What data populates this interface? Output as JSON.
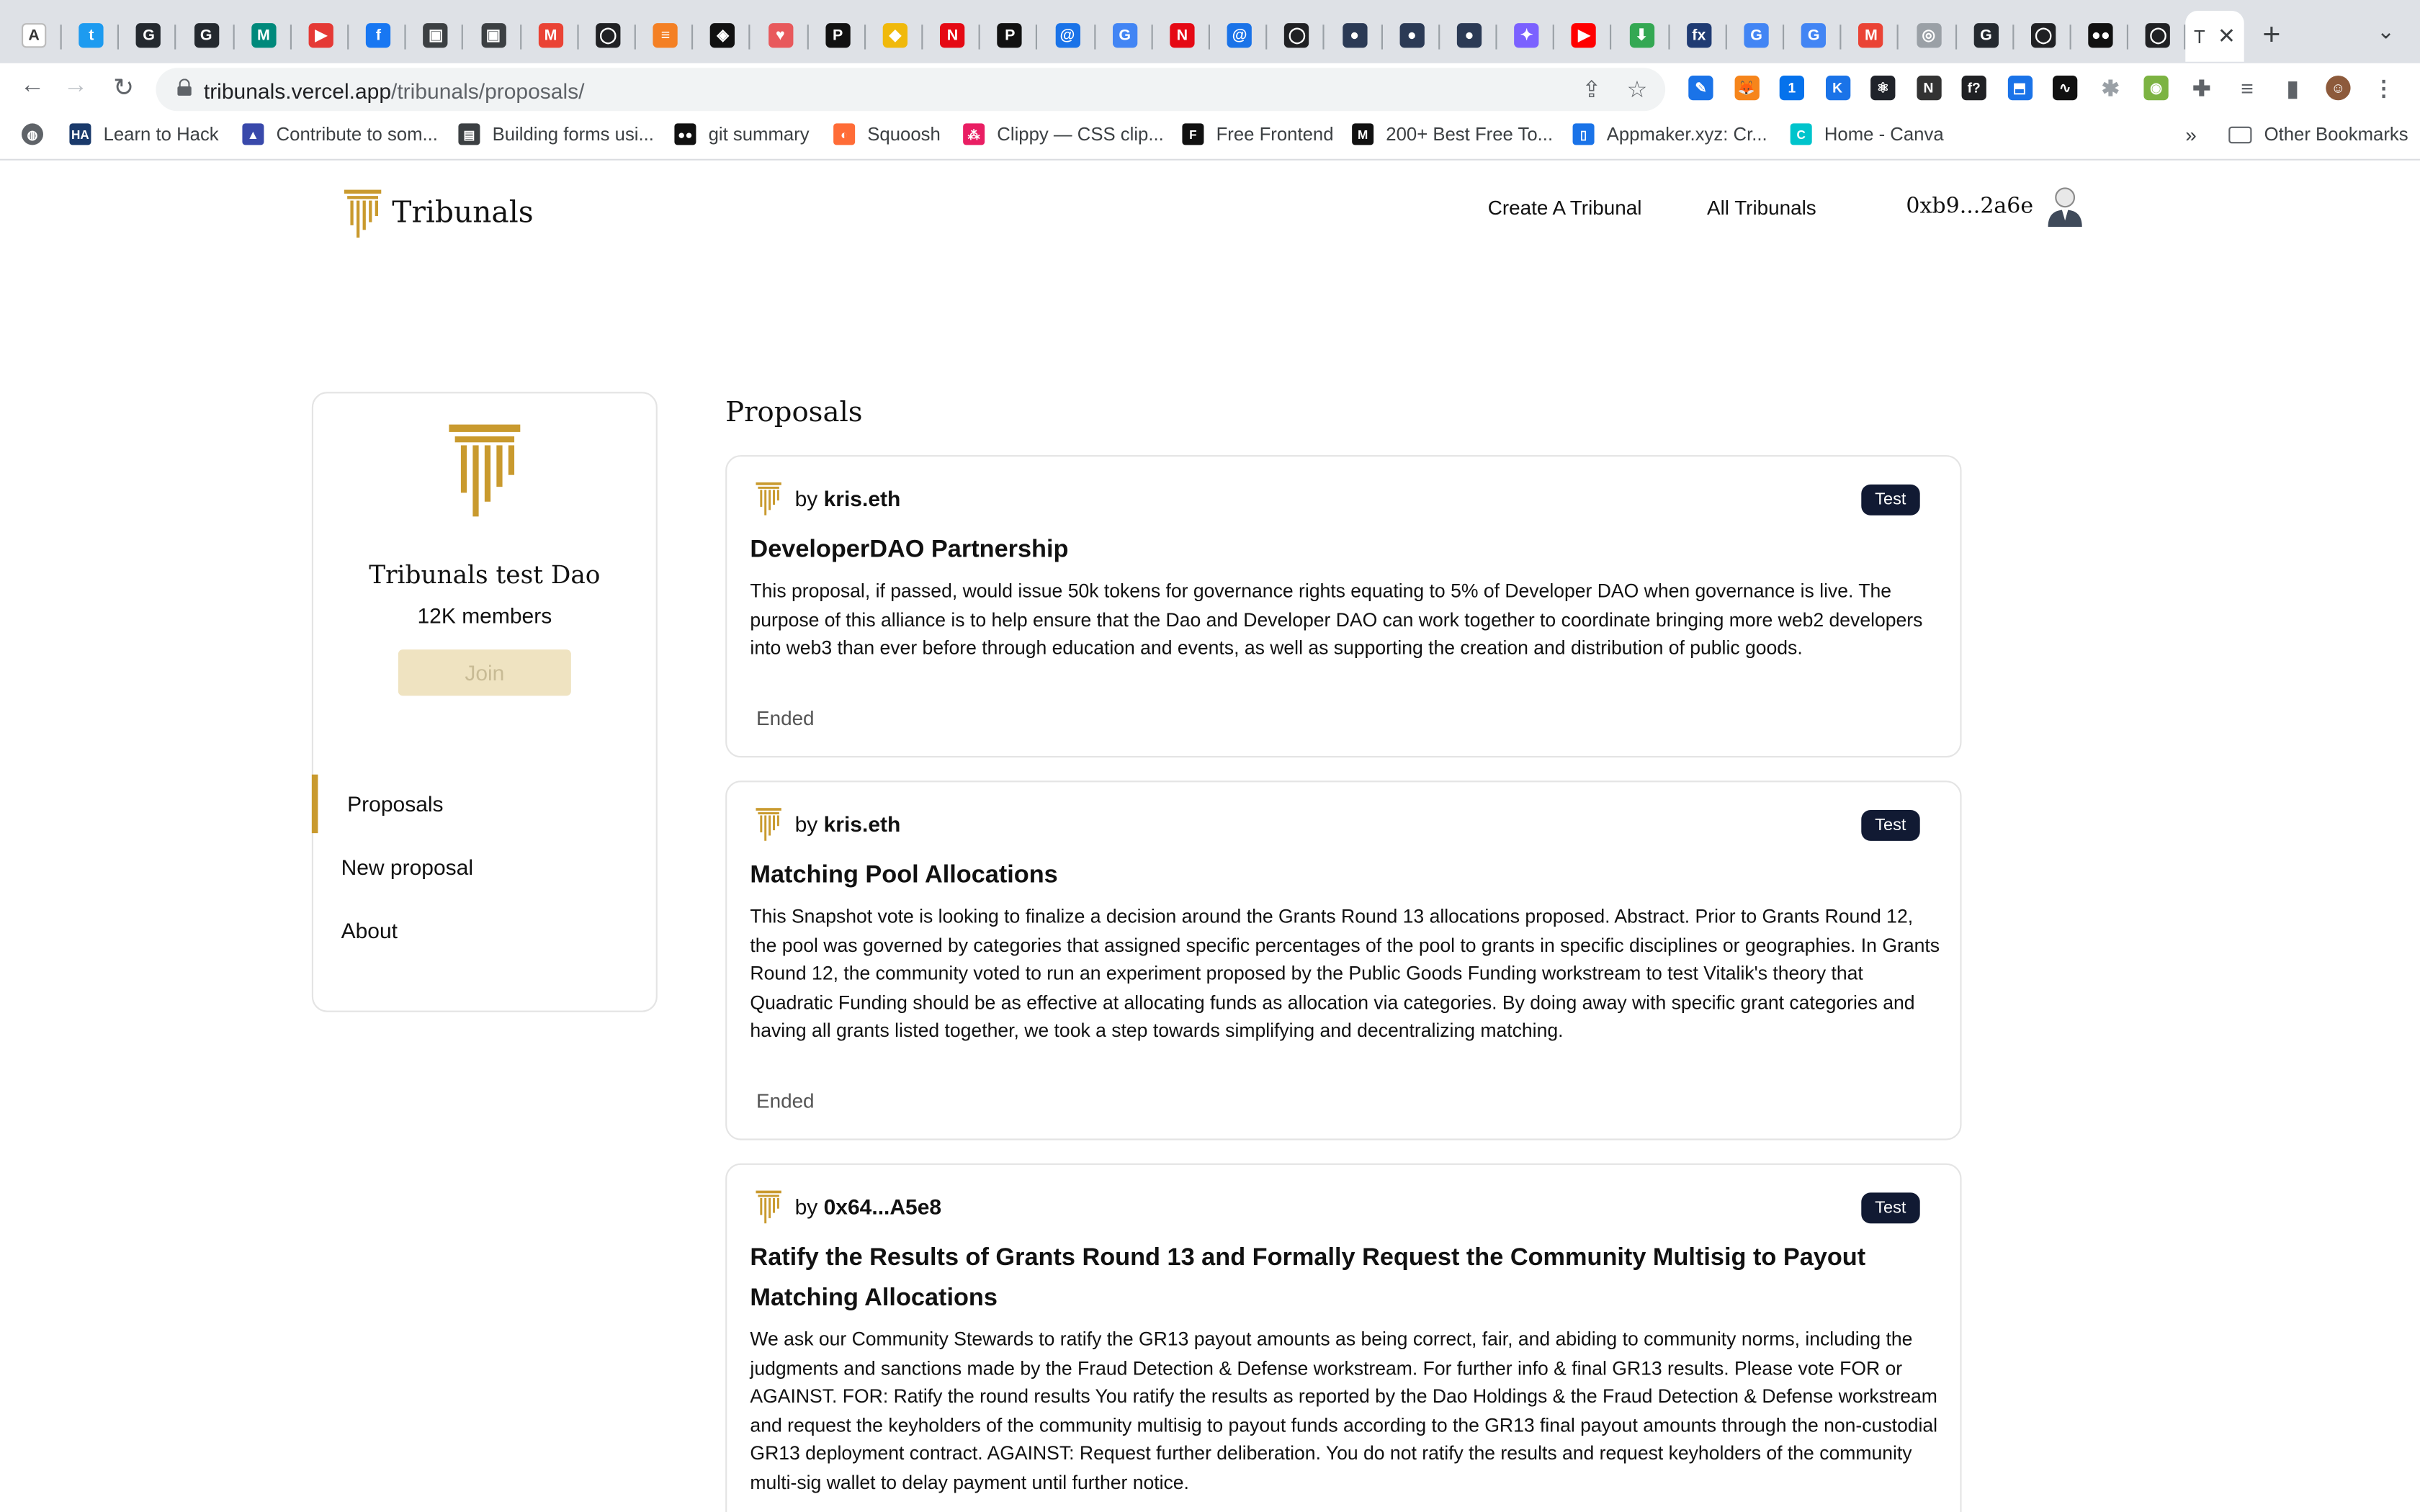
{
  "browser": {
    "url_host": "tribunals.vercel.app",
    "url_path": "/tribunals/proposals/",
    "active_tab_label": "T",
    "new_tab": "+",
    "tabs": [
      {
        "icon": "notion-icon",
        "color": "#ffffff",
        "glyph": "A"
      },
      {
        "icon": "twitter-icon",
        "color": "#1d9bf0",
        "glyph": "t"
      },
      {
        "icon": "github-icon",
        "color": "#24292f",
        "glyph": "G"
      },
      {
        "icon": "github-icon",
        "color": "#24292f",
        "glyph": "G"
      },
      {
        "icon": "meet-icon",
        "color": "#00897b",
        "glyph": "M"
      },
      {
        "icon": "youtube-music-icon",
        "color": "#e53935",
        "glyph": "▶"
      },
      {
        "icon": "facebook-icon",
        "color": "#1877f2",
        "glyph": "f"
      },
      {
        "icon": "image-icon",
        "color": "#3c4043",
        "glyph": "▣"
      },
      {
        "icon": "image-icon",
        "color": "#3c4043",
        "glyph": "▣"
      },
      {
        "icon": "gmail-icon",
        "color": "#ea4335",
        "glyph": "M"
      },
      {
        "icon": "loop-icon",
        "color": "#202124",
        "glyph": "◯"
      },
      {
        "icon": "stackoverflow-icon",
        "color": "#f48024",
        "glyph": "≡"
      },
      {
        "icon": "codesandbox-icon",
        "color": "#111111",
        "glyph": "◈"
      },
      {
        "icon": "pinterest-icon",
        "color": "#e8595c",
        "glyph": "♥"
      },
      {
        "icon": "product-hunt-icon",
        "color": "#111111",
        "glyph": "P"
      },
      {
        "icon": "binance-icon",
        "color": "#f0b90b",
        "glyph": "◆"
      },
      {
        "icon": "netflix-icon",
        "color": "#e50914",
        "glyph": "N"
      },
      {
        "icon": "product-hunt-icon",
        "color": "#111111",
        "glyph": "P"
      },
      {
        "icon": "at-sign-icon",
        "color": "#1a73e8",
        "glyph": "@"
      },
      {
        "icon": "google-icon",
        "color": "#4285f4",
        "glyph": "G"
      },
      {
        "icon": "netflix-icon",
        "color": "#e50914",
        "glyph": "N"
      },
      {
        "icon": "at-sign-icon",
        "color": "#1a73e8",
        "glyph": "@"
      },
      {
        "icon": "loop-icon",
        "color": "#202124",
        "glyph": "◯"
      },
      {
        "icon": "globe-icon",
        "color": "#2b3a55",
        "glyph": "●"
      },
      {
        "icon": "globe-icon",
        "color": "#2b3a55",
        "glyph": "●"
      },
      {
        "icon": "globe-icon",
        "color": "#2b3a55",
        "glyph": "●"
      },
      {
        "icon": "messenger-icon",
        "color": "#7b61ff",
        "glyph": "✦"
      },
      {
        "icon": "youtube-icon",
        "color": "#ff0000",
        "glyph": "▶"
      },
      {
        "icon": "download-icon",
        "color": "#34a853",
        "glyph": "⬇"
      },
      {
        "icon": "fx-icon",
        "color": "#1f3b73",
        "glyph": "fx"
      },
      {
        "icon": "google-icon",
        "color": "#4285f4",
        "glyph": "G"
      },
      {
        "icon": "google-icon",
        "color": "#4285f4",
        "glyph": "G"
      },
      {
        "icon": "gmail-icon",
        "color": "#ea4335",
        "glyph": "M"
      },
      {
        "icon": "apps-icon",
        "color": "#9aa0a6",
        "glyph": "◎"
      },
      {
        "icon": "github-icon",
        "color": "#24292f",
        "glyph": "G"
      },
      {
        "icon": "loop-icon",
        "color": "#202124",
        "glyph": "◯"
      },
      {
        "icon": "medium-icon",
        "color": "#111111",
        "glyph": "●●"
      },
      {
        "icon": "loop-icon",
        "color": "#202124",
        "glyph": "◯"
      }
    ],
    "extensions": [
      {
        "icon": "pen-extension-icon",
        "color": "#1a73e8",
        "glyph": "✎"
      },
      {
        "icon": "metamask-icon",
        "color": "#f6851b",
        "glyph": "🦊"
      },
      {
        "icon": "onepassword-icon",
        "color": "#0572ec",
        "glyph": "1"
      },
      {
        "icon": "k-extension-icon",
        "color": "#1a73e8",
        "glyph": "K"
      },
      {
        "icon": "react-devtools-icon",
        "color": "#20232a",
        "glyph": "⚛"
      },
      {
        "icon": "new-extension-icon",
        "color": "#333333",
        "glyph": "N"
      },
      {
        "icon": "font-extension-icon",
        "color": "#202124",
        "glyph": "f?"
      },
      {
        "icon": "tab-extension-icon",
        "color": "#1a73e8",
        "glyph": "⬒"
      },
      {
        "icon": "wave-extension-icon",
        "color": "#111111",
        "glyph": "∿"
      },
      {
        "icon": "bug-extension-icon",
        "color": "#9aa0a6",
        "glyph": "✱"
      },
      {
        "icon": "color-extension-icon",
        "color": "#7cb342",
        "glyph": "◉"
      },
      {
        "icon": "puzzle-icon",
        "color": "#5f6368",
        "glyph": "✚"
      },
      {
        "icon": "reading-list-icon",
        "color": "#5f6368",
        "glyph": "≡"
      },
      {
        "icon": "sidepanel-icon",
        "color": "#5f6368",
        "glyph": "▮"
      },
      {
        "icon": "profile-avatar-icon",
        "color": "#8d5a3b",
        "glyph": "☺"
      },
      {
        "icon": "kebab-menu-icon",
        "color": "#5f6368",
        "glyph": "⋮"
      }
    ],
    "bookmarks": [
      {
        "label": "",
        "icon": "globe-icon",
        "color": "#5f6368",
        "glyph": "◍"
      },
      {
        "label": "Learn to Hack",
        "icon": "hackaday-icon",
        "color": "#1a3a6b",
        "glyph": "HA"
      },
      {
        "label": "Contribute to som...",
        "icon": "contribute-icon",
        "color": "#3949ab",
        "glyph": "▲"
      },
      {
        "label": "Building forms usi...",
        "icon": "form-icon",
        "color": "#3c4043",
        "glyph": "▤"
      },
      {
        "label": "git summary",
        "icon": "medium-icon",
        "color": "#111111",
        "glyph": "●●"
      },
      {
        "label": "Squoosh",
        "icon": "squoosh-icon",
        "color": "#ff6c37",
        "glyph": "◐"
      },
      {
        "label": "Clippy — CSS clip...",
        "icon": "clippy-icon",
        "color": "#e91e63",
        "glyph": "⁂"
      },
      {
        "label": "Free Frontend",
        "icon": "free-frontend-icon",
        "color": "#111111",
        "glyph": "F"
      },
      {
        "label": "200+ Best Free To...",
        "icon": "m-logo-icon",
        "color": "#111111",
        "glyph": "M"
      },
      {
        "label": "Appmaker.xyz: Cr...",
        "icon": "appmaker-icon",
        "color": "#1a73e8",
        "glyph": "▯"
      },
      {
        "label": "Home - Canva",
        "icon": "canva-icon",
        "color": "#00c4cc",
        "glyph": "C"
      }
    ],
    "bookmarks_more": "»",
    "other_bookmarks": "Other Bookmarks"
  },
  "site": {
    "brand": "Tribunals",
    "nav": {
      "create": "Create A Tribunal",
      "all": "All Tribunals"
    },
    "wallet": "0xb9...2a6e",
    "accent": "#c99a2e"
  },
  "sidebar": {
    "dao_name": "Tribunals test Dao",
    "members": "12K members",
    "join_label": "Join",
    "menu": [
      {
        "label": "Proposals",
        "active": true
      },
      {
        "label": "New proposal",
        "active": false
      },
      {
        "label": "About",
        "active": false
      }
    ]
  },
  "main": {
    "title": "Proposals",
    "proposals": [
      {
        "by_prefix": "by",
        "author": "kris.eth",
        "tag": "Test",
        "title": "DeveloperDAO Partnership",
        "body": "This proposal, if passed, would issue 50k tokens for governance rights equating to 5% of Developer DAO when governance is live. The purpose of this alliance is to help ensure that the Dao and Developer DAO can work together to coordinate bringing more web2 developers into web3 than ever before through education and events, as well as supporting the creation and distribution of public goods.",
        "status": "Ended"
      },
      {
        "by_prefix": "by",
        "author": "kris.eth",
        "tag": "Test",
        "title": "Matching Pool Allocations",
        "body": "This Snapshot vote is looking to finalize a decision around the Grants Round 13 allocations proposed. Abstract. Prior to Grants Round 12, the pool was governed by categories that assigned specific percentages of the pool to grants in specific disciplines or geographies. In Grants Round 12, the community voted to run an experiment proposed by the Public Goods Funding workstream to test Vitalik's theory that Quadratic Funding should be as effective at allocating funds as allocation via categories. By doing away with specific grant categories and having all grants listed together, we took a step towards simplifying and decentralizing matching.",
        "status": "Ended"
      },
      {
        "by_prefix": "by",
        "author": "0x64...A5e8",
        "tag": "Test",
        "title": "Ratify the Results of Grants Round 13 and Formally Request the Community Multisig to Payout Matching Allocations",
        "body": "We ask our Community Stewards to ratify the GR13 payout amounts as being correct, fair, and abiding to community norms, including the judgments and sanctions made by the Fraud Detection & Defense workstream. For further info & final GR13 results. Please vote FOR or AGAINST. FOR: Ratify the round results You ratify the results as reported by the Dao Holdings & the Fraud Detection & Defense workstream and request the keyholders of the community multisig to payout funds according to the GR13 final payout amounts through the non-custodial GR13 deployment contract. AGAINST: Request further deliberation. You do not ratify the results and request keyholders of the community multi-sig wallet to delay payment until further notice.",
        "status": ""
      }
    ]
  }
}
